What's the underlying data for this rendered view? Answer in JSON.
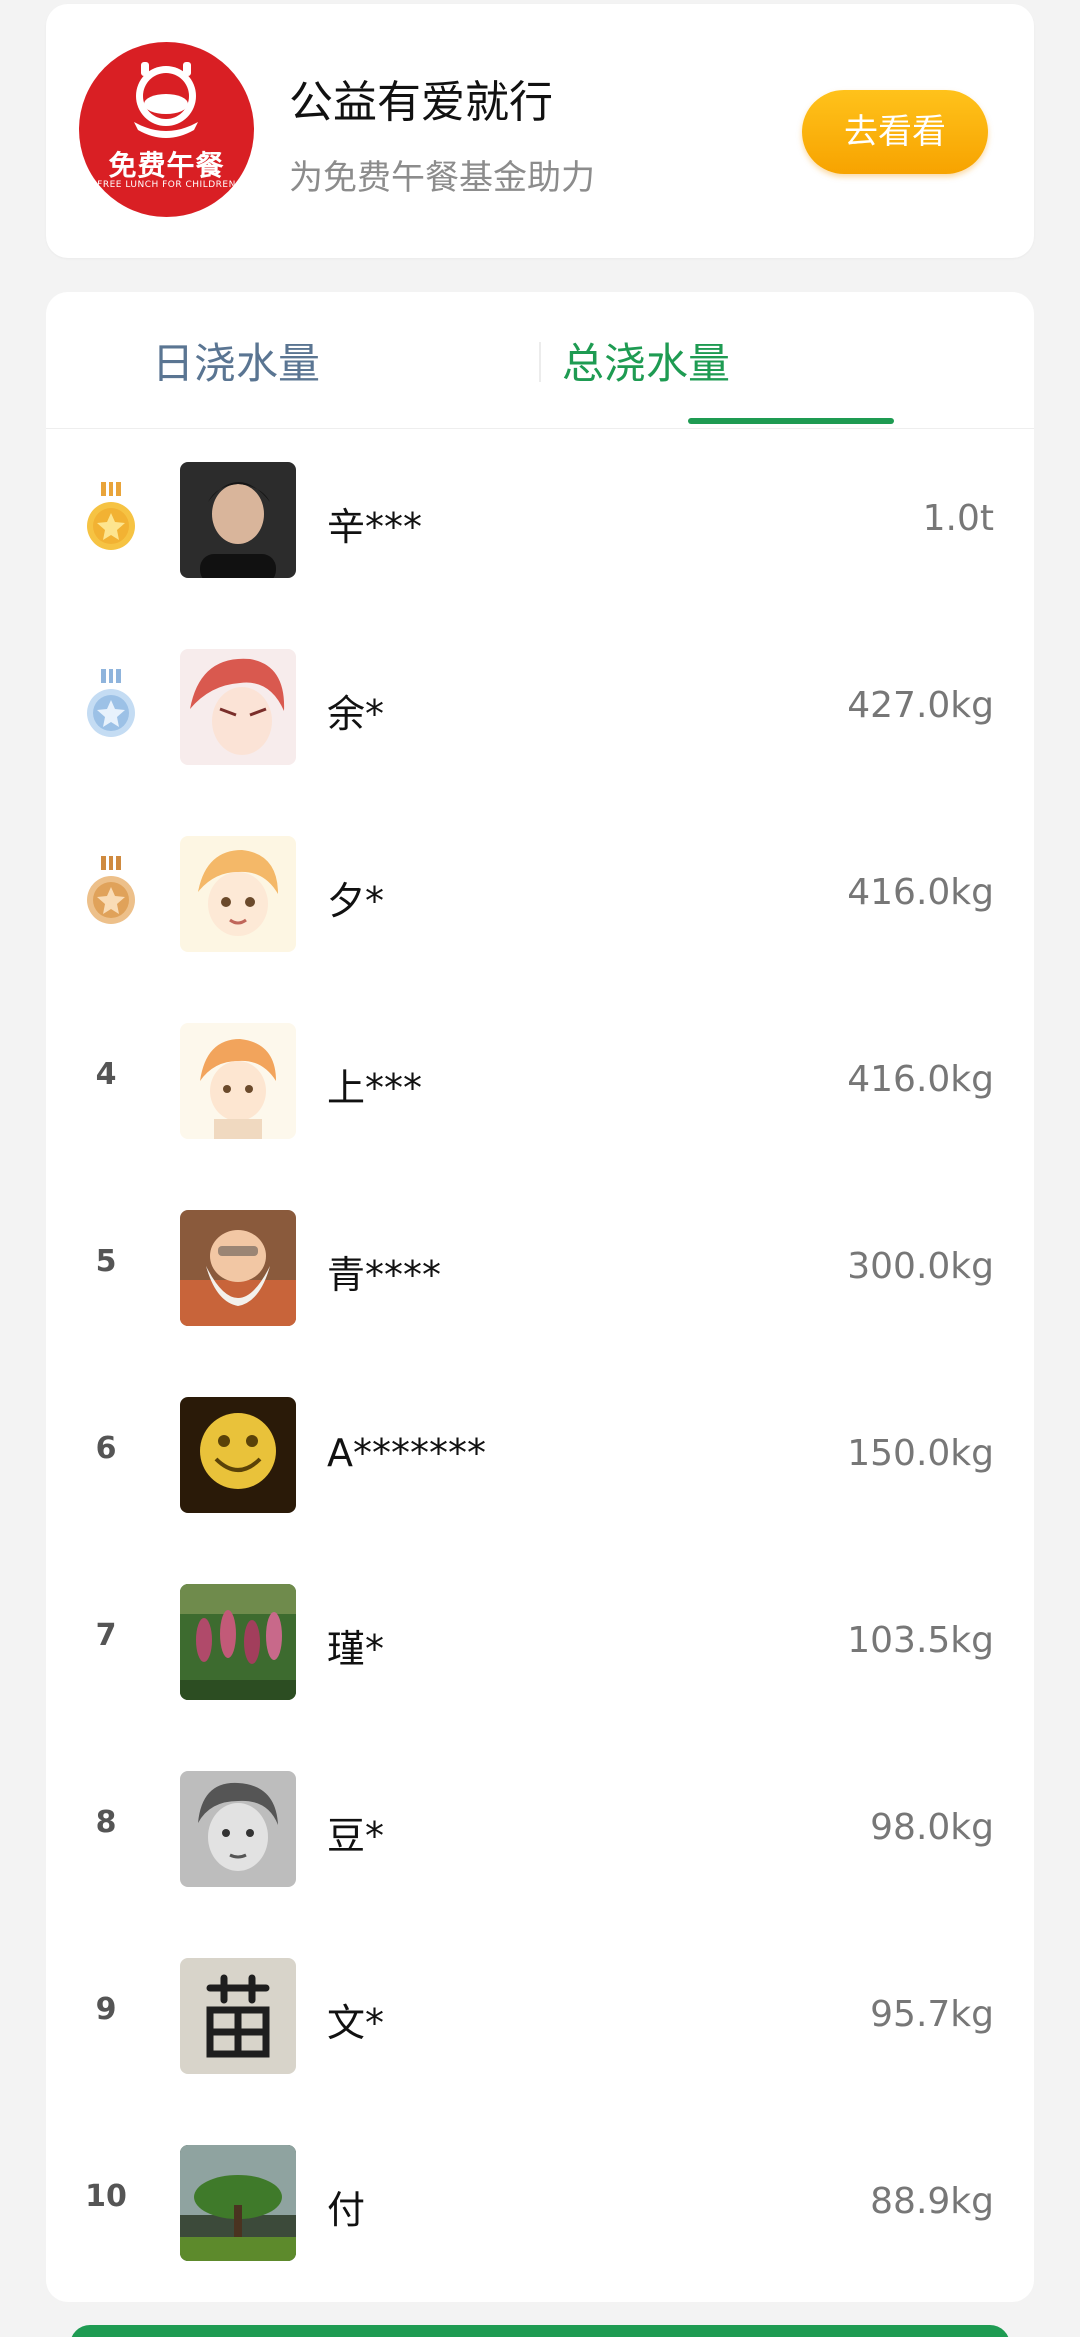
{
  "promo": {
    "logo_text": "免费午餐",
    "logo_sub": "FREE LUNCH FOR CHILDREN",
    "title": "公益有爱就行",
    "subtitle": "为免费午餐基金助力",
    "button_label": "去看看"
  },
  "tabs": [
    {
      "label": "日浇水量",
      "active": false
    },
    {
      "label": "总浇水量",
      "active": true
    }
  ],
  "colors": {
    "accent": "#1e9b52",
    "gold": "#f2b233",
    "silver": "#9cc1e6",
    "bronze": "#e0a25a",
    "promo_button": "#f7a300",
    "logo_red": "#d91f24"
  },
  "ranking": [
    {
      "rank": "1",
      "badge": "gold-medal-icon",
      "name": "辛***",
      "amount": "1.0t"
    },
    {
      "rank": "2",
      "badge": "silver-medal-icon",
      "name": "余*",
      "amount": "427.0kg"
    },
    {
      "rank": "3",
      "badge": "bronze-medal-icon",
      "name": "夕*",
      "amount": "416.0kg"
    },
    {
      "rank": "4",
      "badge": "",
      "name": "上***",
      "amount": "416.0kg"
    },
    {
      "rank": "5",
      "badge": "",
      "name": "青****",
      "amount": "300.0kg"
    },
    {
      "rank": "6",
      "badge": "",
      "name": "A*******",
      "amount": "150.0kg"
    },
    {
      "rank": "7",
      "badge": "",
      "name": "瑾*",
      "amount": "103.5kg"
    },
    {
      "rank": "8",
      "badge": "",
      "name": "豆*",
      "amount": "98.0kg"
    },
    {
      "rank": "9",
      "badge": "",
      "name": "文*",
      "amount": "95.7kg"
    },
    {
      "rank": "10",
      "badge": "",
      "name": "付",
      "amount": "88.9kg"
    }
  ]
}
